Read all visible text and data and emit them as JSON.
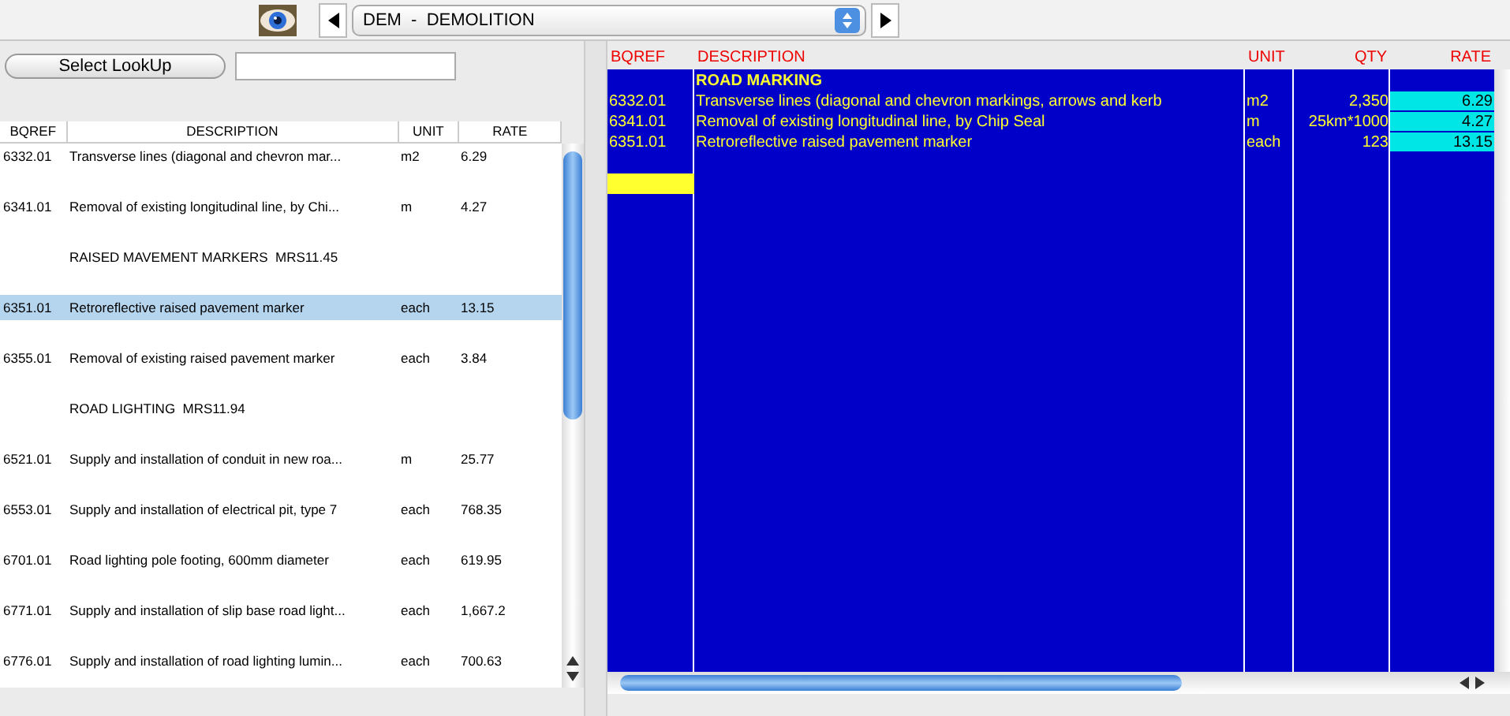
{
  "toolbar": {
    "category": "DEM  -  DEMOLITION"
  },
  "lookup": {
    "button": "Select LookUp"
  },
  "left_table": {
    "columns": [
      "BQREF",
      "DESCRIPTION",
      "UNIT",
      "RATE"
    ],
    "rows": [
      {
        "kind": "item",
        "bqref": "6332.01",
        "description": "Transverse lines (diagonal and chevron mar...",
        "unit": "m2",
        "rate": "6.29",
        "selected": false
      },
      {
        "kind": "item",
        "bqref": "6341.01",
        "description": "Removal of existing longitudinal line, by Chi...",
        "unit": "m",
        "rate": "4.27",
        "selected": false
      },
      {
        "kind": "group",
        "description": "RAISED MAVEMENT MARKERS  MRS11.45",
        "selected": false
      },
      {
        "kind": "item",
        "bqref": "6351.01",
        "description": "Retroreflective raised pavement marker",
        "unit": "each",
        "rate": "13.15",
        "selected": true
      },
      {
        "kind": "item",
        "bqref": "6355.01",
        "description": "Removal of existing raised pavement marker",
        "unit": "each",
        "rate": "3.84",
        "selected": false
      },
      {
        "kind": "group",
        "description": "ROAD LIGHTING  MRS11.94",
        "selected": false
      },
      {
        "kind": "item",
        "bqref": "6521.01",
        "description": "Supply and installation of conduit in new roa...",
        "unit": "m",
        "rate": "25.77",
        "selected": false
      },
      {
        "kind": "item",
        "bqref": "6553.01",
        "description": "Supply and installation of electrical pit, type 7",
        "unit": "each",
        "rate": "768.35",
        "selected": false
      },
      {
        "kind": "item",
        "bqref": "6701.01",
        "description": "Road lighting pole footing, 600mm diameter",
        "unit": "each",
        "rate": "619.95",
        "selected": false
      },
      {
        "kind": "item",
        "bqref": "6771.01",
        "description": "Supply and installation of slip base road light...",
        "unit": "each",
        "rate": "1,667.2",
        "selected": false
      },
      {
        "kind": "item",
        "bqref": "6776.01",
        "description": "Supply and installation of road lighting lumin...",
        "unit": "each",
        "rate": "700.63",
        "selected": false
      }
    ]
  },
  "right_table": {
    "columns": [
      "BQREF",
      "DESCRIPTION",
      "UNIT",
      "QTY",
      "RATE"
    ],
    "rows": [
      {
        "kind": "heading",
        "description": "ROAD MARKING"
      },
      {
        "kind": "item",
        "bqref": "6332.01",
        "description": "Transverse lines (diagonal and chevron markings, arrows and kerb",
        "unit": "m2",
        "qty": "2,350",
        "rate": "6.29"
      },
      {
        "kind": "item",
        "bqref": "6341.01",
        "description": "Removal of existing longitudinal line, by Chip Seal",
        "unit": "m",
        "qty": "25km*1000",
        "rate": "4.27"
      },
      {
        "kind": "item",
        "bqref": "6351.01",
        "description": "Retroreflective raised pavement marker",
        "unit": "each",
        "qty": "123",
        "rate": "13.15"
      }
    ],
    "new_row": {
      "selected": true
    }
  }
}
